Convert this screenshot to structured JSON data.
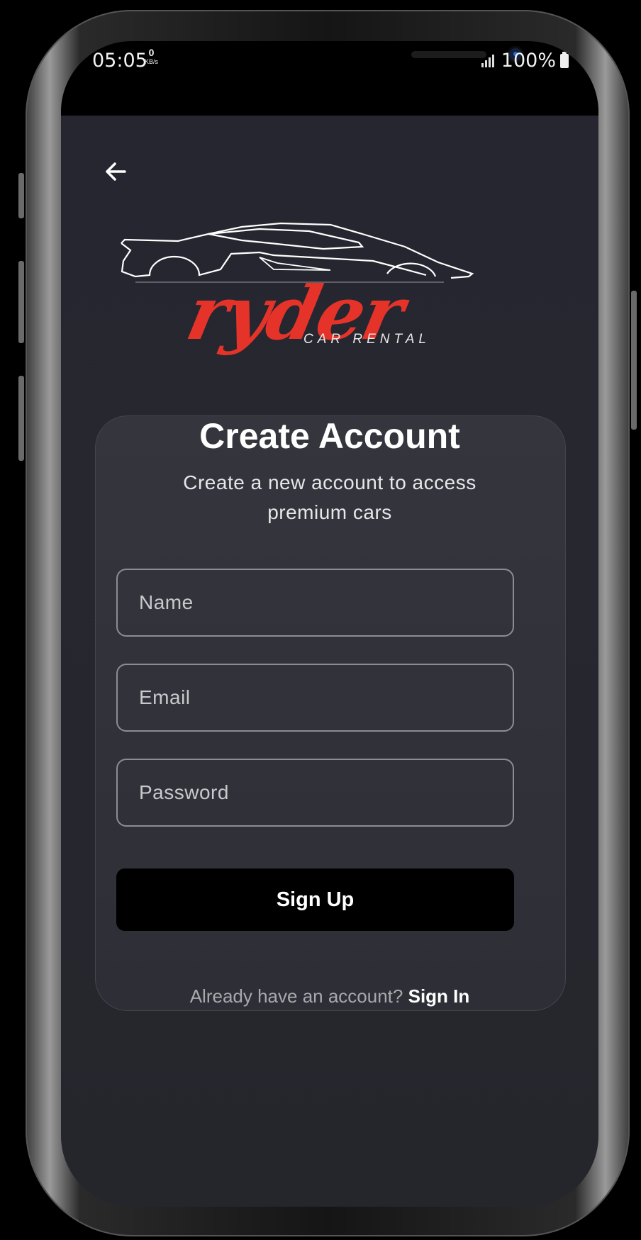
{
  "status_bar": {
    "time": "05:05",
    "net_speed_value": "0",
    "net_speed_unit": "KB/s",
    "battery": "100%"
  },
  "nav": {
    "back_icon": "arrow-left-icon"
  },
  "logo": {
    "brand": "ryder",
    "tagline": "CAR RENTAL",
    "brand_color": "#e5332a",
    "outline_color": "#ffffff"
  },
  "form": {
    "title": "Create Account",
    "subtitle_line1": "Create a new account to access",
    "subtitle_line2": "premium cars",
    "name_placeholder": "Name",
    "email_placeholder": "Email",
    "password_placeholder": "Password",
    "submit_label": "Sign Up"
  },
  "footer": {
    "prompt": "Already have an account?",
    "link_label": "Sign In"
  },
  "colors": {
    "background": "#26262f",
    "card": "#32323a",
    "button": "#000000"
  }
}
